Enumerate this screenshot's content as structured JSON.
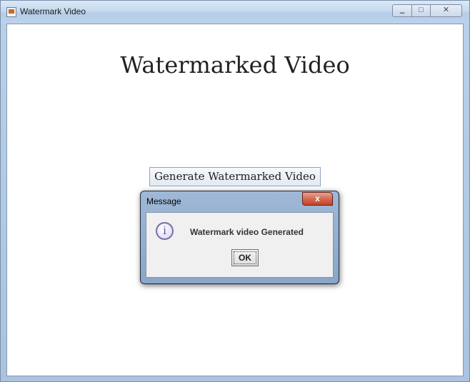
{
  "window": {
    "title": "Watermark Video",
    "minimize_glyph": "‗",
    "maximize_glyph": "□",
    "close_glyph": "✕"
  },
  "main": {
    "heading": "Watermarked Video",
    "generate_button_label": "Generate Watermarked Video"
  },
  "dialog": {
    "title": "Message",
    "close_glyph": "x",
    "icon": "info-icon",
    "icon_glyph": "i",
    "message": "Watermark video Generated",
    "ok_label": "OK"
  }
}
